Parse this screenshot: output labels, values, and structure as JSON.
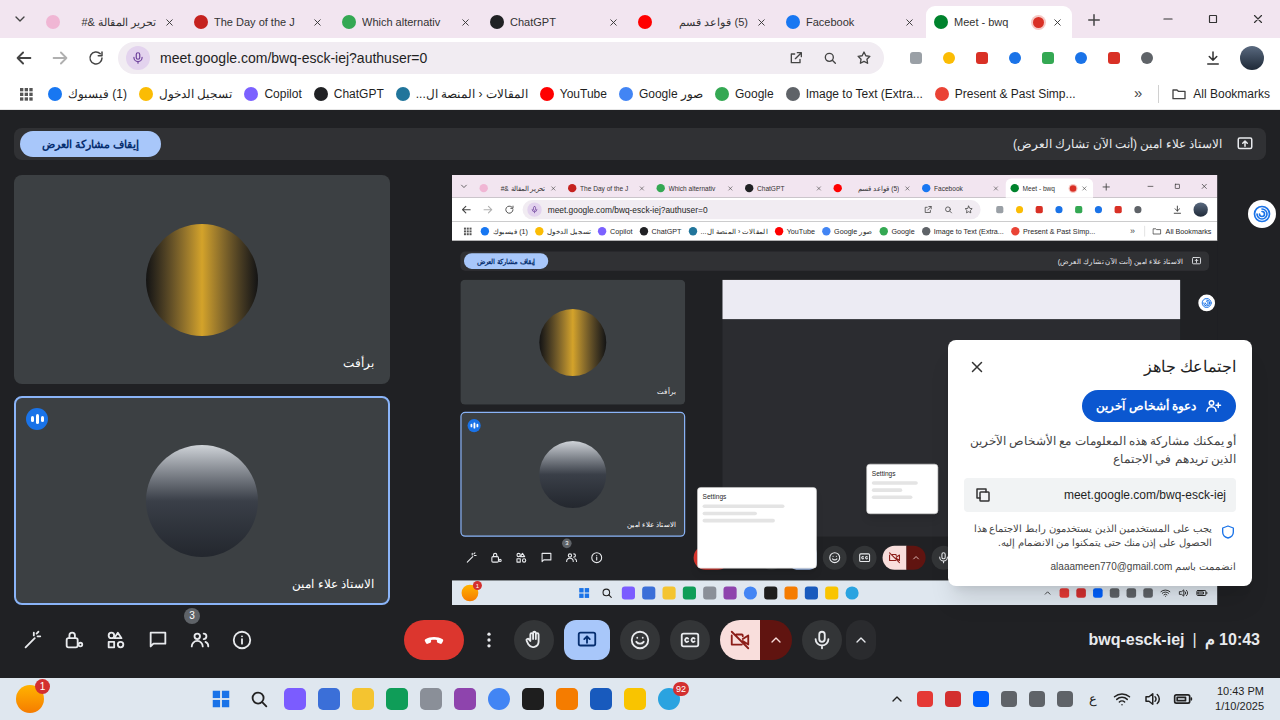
{
  "browser": {
    "tabs": [
      {
        "label": "تحرير المقالة &#",
        "selected": false,
        "recording": false
      },
      {
        "label": "The Day of the J",
        "selected": false,
        "recording": false
      },
      {
        "label": "Which alternativ",
        "selected": false,
        "recording": false
      },
      {
        "label": "ChatGPT",
        "selected": false,
        "recording": false
      },
      {
        "label": "(5) قواعد قسم",
        "selected": false,
        "recording": false
      },
      {
        "label": "Facebook",
        "selected": false,
        "recording": false
      },
      {
        "label": "Meet - bwq",
        "selected": true,
        "recording": true
      }
    ],
    "url": "meet.google.com/bwq-esck-iej?authuser=0",
    "bookmarks": [
      {
        "label": "(1) فيسبوك"
      },
      {
        "label": "تسجيل الدخول"
      },
      {
        "label": "Copilot"
      },
      {
        "label": "ChatGPT"
      },
      {
        "label": "المقالات ‹ المنصة ال..."
      },
      {
        "label": "YouTube"
      },
      {
        "label": "صور Google"
      },
      {
        "label": "Google"
      },
      {
        "label": "Image to Text (Extra..."
      },
      {
        "label": "Present & Past Simp..."
      }
    ],
    "more_bookmarks": "»",
    "all_bookmarks": "All Bookmarks"
  },
  "meet": {
    "banner": {
      "stop_button": "إيقاف مشاركة العرض",
      "status": "الاستاذ علاء امين (أنت الآن تشارك العرض)"
    },
    "tiles": [
      {
        "name": "برأفت",
        "speaking": false
      },
      {
        "name": "الاستاذ علاء امين",
        "speaking": true
      }
    ],
    "bar": {
      "people_count": "3",
      "camera_on": false,
      "mic_on": true,
      "presenting": true,
      "code": "bwq-esck-iej",
      "separator": "|",
      "time": "10:43 م"
    }
  },
  "dialog": {
    "title": "اجتماعك جاهز",
    "invite_button": "دعوة أشخاص آخرين",
    "description": "أو يمكنك مشاركة هذه المعلومات مع الأشخاص الآخرين الذين تريدهم في الاجتماع",
    "link": "meet.google.com/bwq-esck-iej",
    "notice": "يجب على المستخدمين الذين يستخدمون رابط الاجتماع هذا الحصول على إذن منك حتى يتمكنوا من الانضمام إليه.",
    "joined_as": "انضممت باسم alaaameen770@gmail.com"
  },
  "taskbar": {
    "weather_badge": "1",
    "app_badge": "92",
    "language": "ع",
    "time": "10:43 PM",
    "date": "1/10/2025"
  },
  "shared_screen": {
    "browser": {
      "tabs": [
        {
          "label": "تحرير المقالة &#",
          "selected": false,
          "recording": false
        },
        {
          "label": "The Day of the J",
          "selected": false,
          "recording": false
        },
        {
          "label": "Which alternativ",
          "selected": false,
          "recording": false
        },
        {
          "label": "ChatGPT",
          "selected": false,
          "recording": false
        },
        {
          "label": "(5) قواعد قسم",
          "selected": false,
          "recording": false
        },
        {
          "label": "Facebook",
          "selected": false,
          "recording": false
        },
        {
          "label": "Meet - bwq",
          "selected": true,
          "recording": true
        }
      ],
      "url": "meet.google.com/bwq-esck-iej?authuser=0",
      "bookmarks": [
        {
          "label": "(1) فيسبوك"
        },
        {
          "label": "تسجيل الدخول"
        },
        {
          "label": "Copilot"
        },
        {
          "label": "ChatGPT"
        },
        {
          "label": "المقالات ‹ المنصة ال..."
        },
        {
          "label": "YouTube"
        },
        {
          "label": "صور Google"
        },
        {
          "label": "Google"
        },
        {
          "label": "Image to Text (Extra..."
        },
        {
          "label": "Present & Past Simp..."
        }
      ],
      "more_bookmarks": "»",
      "all_bookmarks": "All Bookmarks"
    },
    "meet": {
      "banner": {
        "stop_button": "إيقاف مشاركة العرض",
        "status": "الاستاذ علاء امين (أنت الآن تشارك العرض)"
      },
      "tiles": [
        {
          "name": "برأفت",
          "speaking": false
        },
        {
          "name": "الاستاذ علاء امين",
          "speaking": true
        }
      ],
      "bar": {
        "people_count": "3",
        "camera_on": false,
        "mic_on": true,
        "presenting": true
      }
    },
    "taskbar": {
      "weather_badge": "1"
    },
    "windows": [
      {
        "title": "Settings"
      },
      {
        "title": "Settings"
      }
    ]
  }
}
